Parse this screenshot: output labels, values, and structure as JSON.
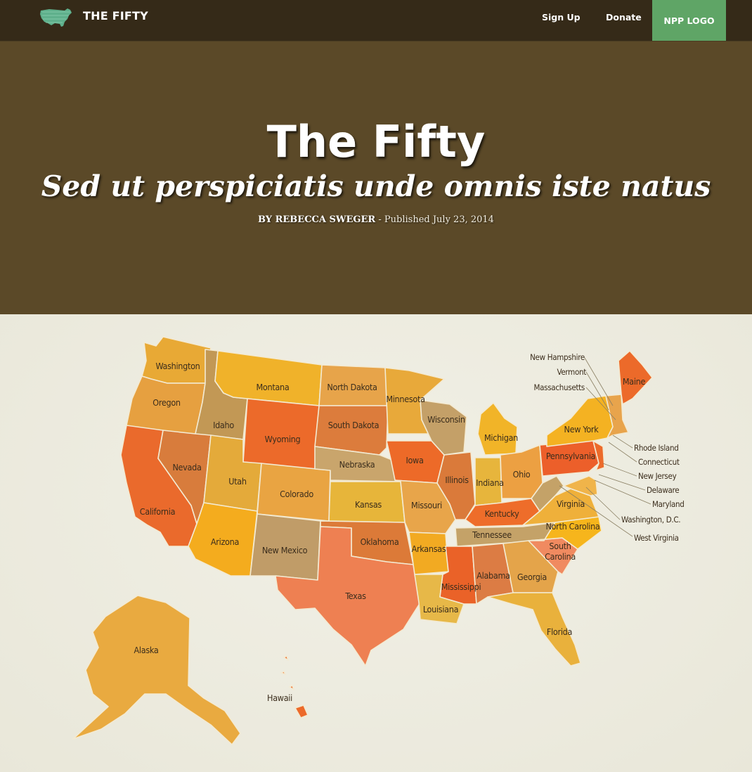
{
  "topbar": {
    "brand_title": "THE FIFTY",
    "brand_icon": "usa-map-icon",
    "nav": [
      "Sign Up",
      "Donate"
    ],
    "logo_label": "NPP LOGO",
    "colors": {
      "bar": "#352a18",
      "logo_bg": "#5fa566"
    }
  },
  "hero": {
    "title": "The Fifty",
    "subtitle": "Sed ut perspiciatis unde omnis iste natus",
    "byline_author": "BY REBECCA SWEGER",
    "byline_rest": " - Published July 23, 2014",
    "background": "#5b4928"
  },
  "map": {
    "states": [
      {
        "id": "washington",
        "label": "Washington",
        "color": "#e8a935"
      },
      {
        "id": "oregon",
        "label": "Oregon",
        "color": "#e6a040"
      },
      {
        "id": "california",
        "label": "California",
        "color": "#ea6a2c"
      },
      {
        "id": "idaho",
        "label": "Idaho",
        "color": "#c29855"
      },
      {
        "id": "nevada",
        "label": "Nevada",
        "color": "#d87c3c"
      },
      {
        "id": "montana",
        "label": "Montana",
        "color": "#f0b22a"
      },
      {
        "id": "wyoming",
        "label": "Wyoming",
        "color": "#ec6a2a"
      },
      {
        "id": "utah",
        "label": "Utah",
        "color": "#e4aa3a"
      },
      {
        "id": "arizona",
        "label": "Arizona",
        "color": "#f4ac1e"
      },
      {
        "id": "colorado",
        "label": "Colorado",
        "color": "#e9a442"
      },
      {
        "id": "new_mexico",
        "label": "New Mexico",
        "color": "#c09c68"
      },
      {
        "id": "north_dakota",
        "label": "North Dakota",
        "color": "#e7a44a"
      },
      {
        "id": "south_dakota",
        "label": "South Dakota",
        "color": "#dc7c3c"
      },
      {
        "id": "nebraska",
        "label": "Nebraska",
        "color": "#c9a56c"
      },
      {
        "id": "kansas",
        "label": "Kansas",
        "color": "#e7b53a"
      },
      {
        "id": "oklahoma",
        "label": "Oklahoma",
        "color": "#dc7a38"
      },
      {
        "id": "texas",
        "label": "Texas",
        "color": "#ee8052"
      },
      {
        "id": "minnesota",
        "label": "Minnesota",
        "color": "#e8a93a"
      },
      {
        "id": "iowa",
        "label": "Iowa",
        "color": "#ed6a28"
      },
      {
        "id": "missouri",
        "label": "Missouri",
        "color": "#e8a54a"
      },
      {
        "id": "arkansas",
        "label": "Arkansas",
        "color": "#f2aa22"
      },
      {
        "id": "louisiana",
        "label": "Louisiana",
        "color": "#e7b848"
      },
      {
        "id": "wisconsin",
        "label": "Wisconsin",
        "color": "#c4a068"
      },
      {
        "id": "illinois",
        "label": "Illinois",
        "color": "#da7a3a"
      },
      {
        "id": "michigan",
        "label": "Michigan",
        "color": "#f1b428"
      },
      {
        "id": "indiana",
        "label": "Indiana",
        "color": "#e7b53c"
      },
      {
        "id": "ohio",
        "label": "Ohio",
        "color": "#eca042"
      },
      {
        "id": "kentucky",
        "label": "Kentucky",
        "color": "#ee6d2a"
      },
      {
        "id": "tennessee",
        "label": "Tennessee",
        "color": "#c4a268"
      },
      {
        "id": "mississippi",
        "label": "Mississippi",
        "color": "#ea6228"
      },
      {
        "id": "alabama",
        "label": "Alabama",
        "color": "#dc7c44"
      },
      {
        "id": "georgia",
        "label": "Georgia",
        "color": "#e4a44a"
      },
      {
        "id": "florida",
        "label": "Florida",
        "color": "#e9b13c"
      },
      {
        "id": "south_carolina",
        "label": "South Carolina",
        "color": "#f08a60"
      },
      {
        "id": "north_carolina",
        "label": "North Carolina",
        "color": "#f6b51c"
      },
      {
        "id": "virginia",
        "label": "Virginia",
        "color": "#efb03a"
      },
      {
        "id": "west_virginia",
        "label": "West Virginia",
        "color": "#c4a268"
      },
      {
        "id": "pennsylvania",
        "label": "Pennsylvania",
        "color": "#ec5f2a"
      },
      {
        "id": "new_york",
        "label": "New York",
        "color": "#f4b222"
      },
      {
        "id": "maine",
        "label": "Maine",
        "color": "#ec6a2a"
      },
      {
        "id": "new_england_small",
        "label": "",
        "color": "#e8a44c"
      },
      {
        "id": "new_jersey",
        "label": "New Jersey",
        "color": "#ec6a2a"
      },
      {
        "id": "maryland",
        "label": "Maryland",
        "color": "#f0b44a"
      },
      {
        "id": "alaska",
        "label": "Alaska",
        "color": "#e9aa40"
      },
      {
        "id": "hawaii",
        "label": "Hawaii",
        "color": "#ec6a2a"
      }
    ],
    "callouts": [
      "New Hampshire",
      "Vermont",
      "Massachusetts",
      "Rhode Island",
      "Connecticut",
      "New Jersey",
      "Delaware",
      "Maryland",
      "Washington, D.C.",
      "West Virginia"
    ]
  }
}
